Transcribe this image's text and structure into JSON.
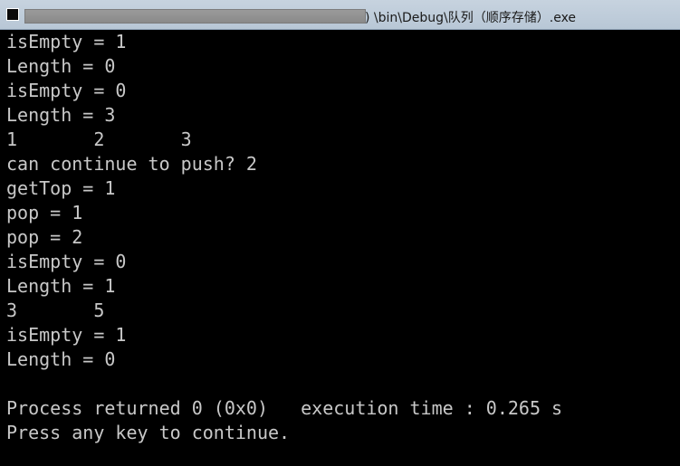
{
  "window": {
    "title_suffix": ") \\bin\\Debug\\队列（顺序存储）.exe"
  },
  "console": {
    "lines": [
      "isEmpty = 1",
      "Length = 0",
      "isEmpty = 0",
      "Length = 3",
      "1       2       3",
      "can continue to push? 2",
      "getTop = 1",
      "pop = 1",
      "pop = 2",
      "isEmpty = 0",
      "Length = 1",
      "3       5",
      "isEmpty = 1",
      "Length = 0",
      "",
      "Process returned 0 (0x0)   execution time : 0.265 s",
      "Press any key to continue."
    ]
  }
}
